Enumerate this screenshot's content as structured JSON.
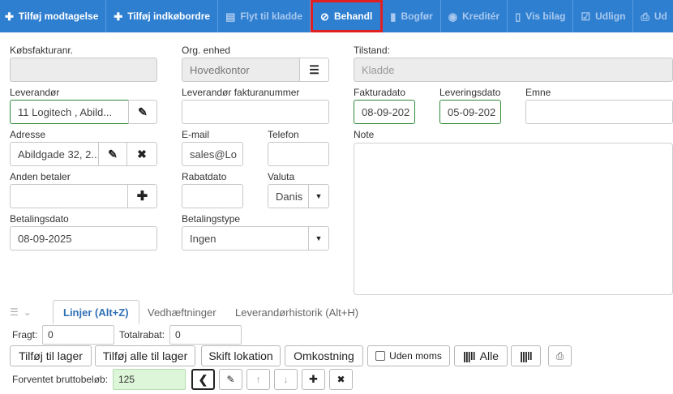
{
  "toolbar": {
    "add_receipt": "Tilføj modtagelse",
    "add_purchase_order": "Tilføj indkøbordre",
    "move_to_draft": "Flyt til kladde",
    "process": "Behandl",
    "post": "Bogfør",
    "credit": "Kreditér",
    "show_voucher": "Vis bilag",
    "settle": "Udlign",
    "print": "Ud"
  },
  "form": {
    "invoice_no_label": "Købsfakturanr.",
    "invoice_no_value": "",
    "org_unit_label": "Org. enhed",
    "org_unit_value": "Hovedkontor",
    "status_label": "Tilstand:",
    "status_value": "Kladde",
    "supplier_label": "Leverandør",
    "supplier_value": "11 Logitech , Abild...",
    "supplier_invoice_label": "Leverandør fakturanummer",
    "supplier_invoice_value": "",
    "invoice_date_label": "Fakturadato",
    "invoice_date_value": "08-09-202",
    "delivery_date_label": "Leveringsdato",
    "delivery_date_value": "05-09-202",
    "subject_label": "Emne",
    "subject_value": "",
    "address_label": "Adresse",
    "address_value": "Abildgade 32, 2...",
    "email_label": "E-mail",
    "email_value": "sales@Lo",
    "phone_label": "Telefon",
    "phone_value": "",
    "note_label": "Note",
    "other_payer_label": "Anden betaler",
    "other_payer_value": "",
    "discount_date_label": "Rabatdato",
    "discount_date_value": "",
    "currency_label": "Valuta",
    "currency_value": "Danis",
    "payment_date_label": "Betalingsdato",
    "payment_date_value": "08-09-2025",
    "payment_type_label": "Betalingstype",
    "payment_type_value": "Ingen"
  },
  "tabs": {
    "lines": "Linjer (Alt+Z)",
    "attachments": "Vedhæftninger",
    "supplier_history": "Leverandørhistorik (Alt+H)"
  },
  "lines": {
    "freight_label": "Fragt:",
    "freight_value": "0",
    "total_discount_label": "Totalrabat:",
    "total_discount_value": "0",
    "add_to_stock": "Tilføj til lager",
    "add_all_to_stock": "Tilføj alle til lager",
    "change_location": "Skift lokation",
    "cost": "Omkostning",
    "without_vat": "Uden moms",
    "all": "Alle",
    "expected_gross_label": "Forventet bruttobeløb:",
    "expected_gross_value": "125"
  }
}
